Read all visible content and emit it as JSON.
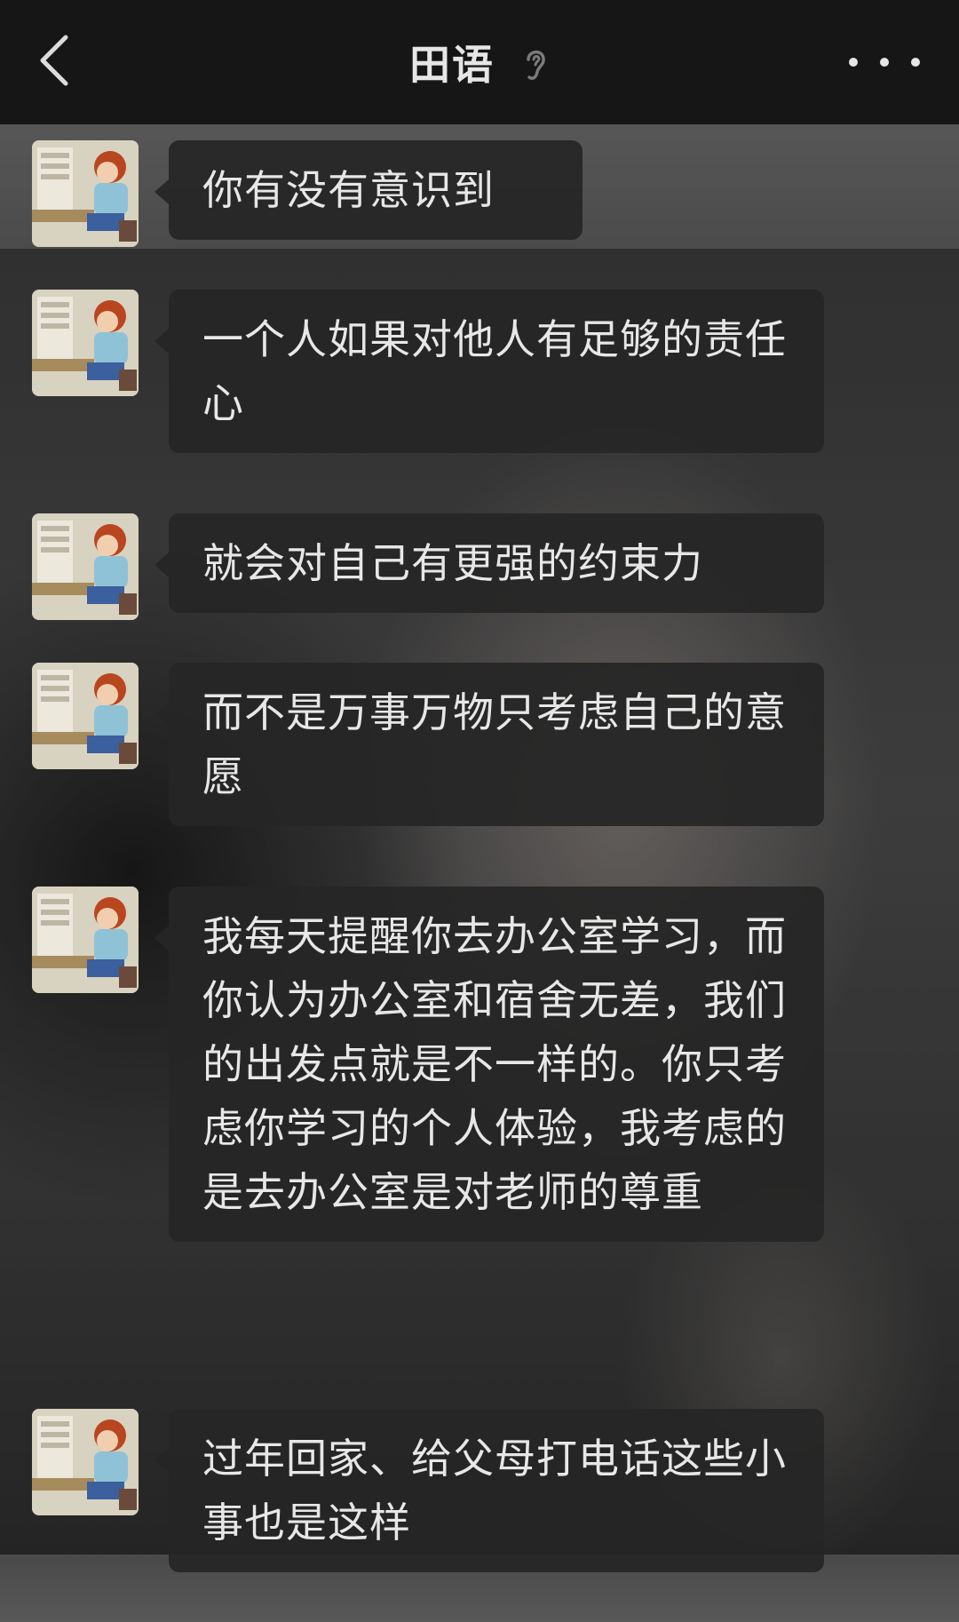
{
  "header": {
    "title": "田语",
    "back_icon": "chevron-left-icon",
    "mute_icon": "ear-icon",
    "more_icon": "more-dots-icon"
  },
  "colors": {
    "navbar": "#161616",
    "bubble": "#262626",
    "text": "#e7e7e7"
  },
  "messages": [
    {
      "text": "你有没有意识到"
    },
    {
      "text": "一个人如果对他人有足够的责任心"
    },
    {
      "text": "就会对自己有更强的约束力"
    },
    {
      "text": "而不是万事万物只考虑自己的意愿"
    },
    {
      "text": "我每天提醒你去办公室学习，而你认为办公室和宿舍无差，我们的出发点就是不一样的。你只考虑你学习的个人体验，我考虑的是去办公室是对老师的尊重"
    },
    {
      "text": "过年回家、给父母打电话这些小事也是这样"
    }
  ]
}
